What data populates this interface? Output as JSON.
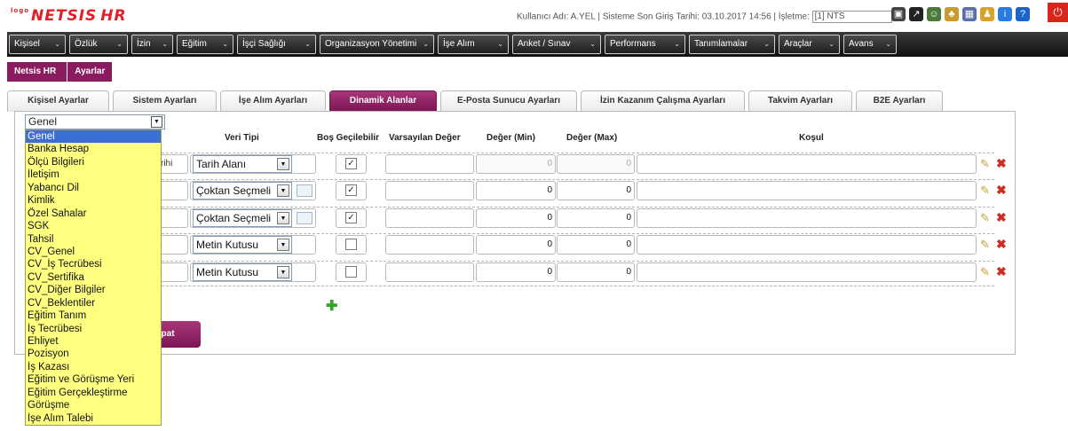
{
  "app": {
    "logo_prefix": "logo",
    "logo_text": "NETSIS",
    "logo_suffix": "HR"
  },
  "userinfo": {
    "text": "Kullanıcı Adı: A.YEL | Sisteme Son Giriş Tarihi: 03.10.2017 14:56 | İşletme:",
    "company_value": "[1] NTS"
  },
  "toolbar_icons": [
    {
      "name": "window-icon",
      "glyph": "▣",
      "color": "#444444"
    },
    {
      "name": "external-link-icon",
      "glyph": "↗",
      "color": "#222222"
    },
    {
      "name": "chat-icon",
      "glyph": "☺",
      "color": "#4a7a3a"
    },
    {
      "name": "users-icon",
      "glyph": "♣",
      "color": "#c99a2e"
    },
    {
      "name": "calendar-icon",
      "glyph": "▦",
      "color": "#5b6fa8"
    },
    {
      "name": "user-key-icon",
      "glyph": "♟",
      "color": "#d8a22c"
    },
    {
      "name": "info-icon",
      "glyph": "i",
      "color": "#2a7be0"
    },
    {
      "name": "help-icon",
      "glyph": "?",
      "color": "#1a64c8"
    }
  ],
  "menu": [
    {
      "label": "Kişisel"
    },
    {
      "label": "Özlük"
    },
    {
      "label": "İzin"
    },
    {
      "label": "Eğitim"
    },
    {
      "label": "İşçi Sağlığı"
    },
    {
      "label": "Organizasyon Yönetimi"
    },
    {
      "label": "İşe Alım"
    },
    {
      "label": "Anket / Sınav"
    },
    {
      "label": "Performans"
    },
    {
      "label": "Tanımlamalar"
    },
    {
      "label": "Araçlar"
    },
    {
      "label": "Avans"
    }
  ],
  "breadcrumb": [
    "Netsis HR",
    "Ayarlar"
  ],
  "tabs": [
    {
      "label": "Kişisel Ayarlar"
    },
    {
      "label": "Sistem Ayarları"
    },
    {
      "label": "İşe Alım Ayarları"
    },
    {
      "label": "Dinamik Alanlar",
      "active": true
    },
    {
      "label": "E-Posta Sunucu Ayarları"
    },
    {
      "label": "İzin Kazanım Çalışma Ayarları"
    },
    {
      "label": "Takvim Ayarları"
    },
    {
      "label": "B2E Ayarları"
    }
  ],
  "table": {
    "headers": {
      "veri_tipi": "Veri Tipi",
      "bos": "Boş Geçilebilir",
      "varsayilan": "Varsayılan Değer",
      "min": "Değer (Min)",
      "max": "Değer (Max)",
      "kosul": "Koşul"
    },
    "rows": [
      {
        "left_text": "rihi",
        "type": "Tarih Alanı",
        "list": false,
        "checked": true,
        "min": "0",
        "max": "0",
        "disabled": true
      },
      {
        "left_text": "",
        "type": "Çoktan Seçmeli",
        "list": true,
        "checked": true,
        "min": "0",
        "max": "0",
        "disabled": false
      },
      {
        "left_text": "",
        "type": "Çoktan Seçmeli",
        "list": true,
        "checked": true,
        "min": "0",
        "max": "0",
        "disabled": false
      },
      {
        "left_text": "",
        "type": "Metin Kutusu",
        "list": false,
        "checked": false,
        "min": "0",
        "max": "0",
        "disabled": false
      },
      {
        "left_text": "",
        "type": "Metin Kutusu",
        "list": false,
        "checked": false,
        "min": "0",
        "max": "0",
        "disabled": false
      }
    ]
  },
  "close_label": "apat",
  "category": {
    "selected": "Genel",
    "options": [
      "Genel",
      "Banka Hesap",
      "Ölçü Bilgileri",
      "İletişim",
      "Yabancı Dil",
      "Kimlik",
      "Özel Sahalar",
      "SGK",
      "Tahsil",
      "CV_Genel",
      "CV_İş Tecrübesi",
      "CV_Sertifika",
      "CV_Diğer Bilgiler",
      "CV_Beklentiler",
      "Eğitim Tanım",
      "İş Tecrübesi",
      "Ehliyet",
      "Pozisyon",
      "İş Kazası",
      "Eğitim ve Görüşme Yeri",
      "Eğitim Gerçekleştirme",
      "Görüşme",
      "İşe Alım Talebi"
    ]
  },
  "colors": {
    "accent": "#8a1b5e",
    "menu_bg": "#1e1e1e",
    "dropdown_bg": "#ffff80",
    "selected_option": "#3a6fd6"
  }
}
